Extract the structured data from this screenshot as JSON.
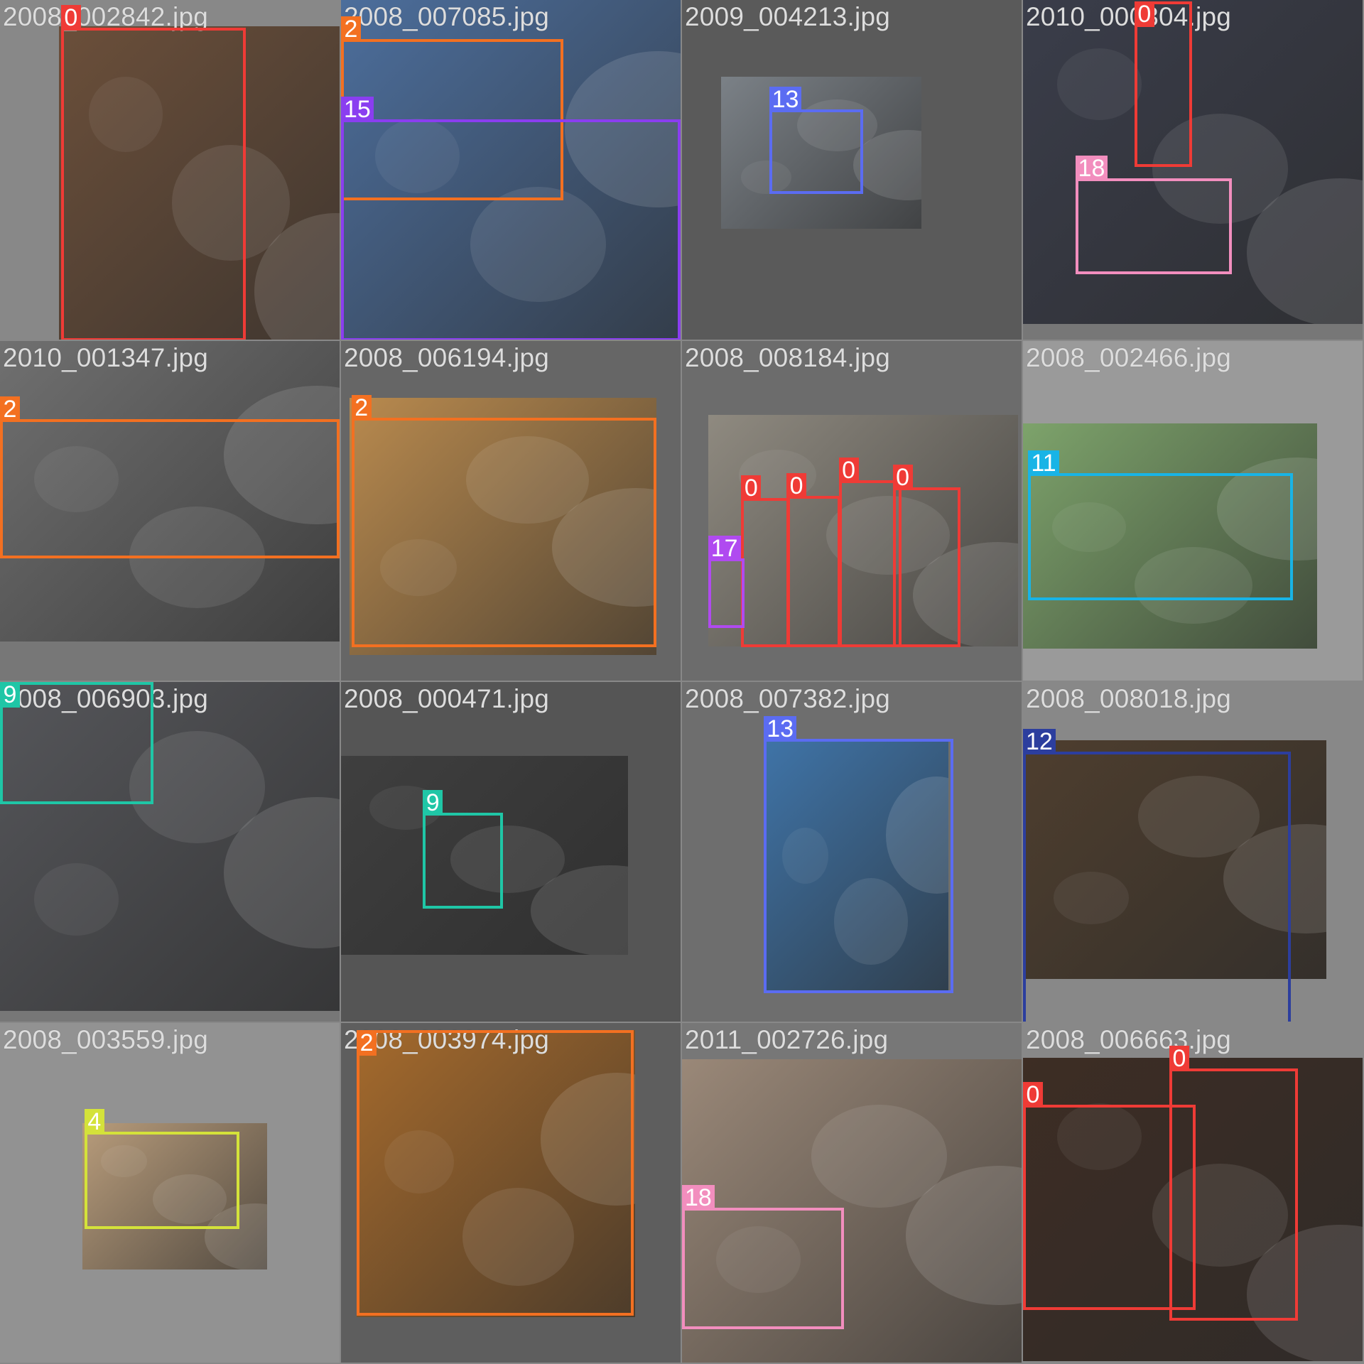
{
  "classes": {
    "0": {
      "color": "#ef3b36"
    },
    "2": {
      "color": "#f37021"
    },
    "4": {
      "color": "#d4e23a"
    },
    "9": {
      "color": "#1fc6a6"
    },
    "11": {
      "color": "#18b4e6"
    },
    "12": {
      "color": "#2c3e9e"
    },
    "13": {
      "color": "#5b6cf2"
    },
    "15": {
      "color": "#8a3ef0"
    },
    "17": {
      "color": "#b04af0"
    },
    "18": {
      "color": "#f28ebe"
    }
  },
  "tiles": [
    {
      "file": "2008_002842.jpg",
      "bg": "#888888",
      "photo": "#6b4f3a",
      "labels": [
        "0"
      ]
    },
    {
      "file": "2008_007085.jpg",
      "bg": "#888888",
      "photo": "#4c6e9c",
      "labels": [
        "2",
        "15"
      ]
    },
    {
      "file": "2009_004213.jpg",
      "bg": "#5a5a5a",
      "photo": "#7b8187",
      "labels": [
        "13"
      ]
    },
    {
      "file": "2010_000304.jpg",
      "bg": "#777777",
      "photo": "#3a3d4a",
      "labels": [
        "0",
        "18"
      ]
    },
    {
      "file": "2010_001347.jpg",
      "bg": "#777777",
      "photo": "#707070",
      "labels": [
        "2"
      ]
    },
    {
      "file": "2008_006194.jpg",
      "bg": "#666666",
      "photo": "#b98a4e",
      "labels": [
        "2"
      ]
    },
    {
      "file": "2008_008184.jpg",
      "bg": "#6c6c6c",
      "photo": "#8f8a80",
      "labels": [
        "0",
        "0",
        "0",
        "0",
        "17"
      ]
    },
    {
      "file": "2008_002466.jpg",
      "bg": "#9a9a9a",
      "photo": "#7da36b",
      "labels": [
        "11"
      ]
    },
    {
      "file": "2008_006903.jpg",
      "bg": "#777777",
      "photo": "#55565a",
      "labels": [
        "9"
      ]
    },
    {
      "file": "2008_000471.jpg",
      "bg": "#555555",
      "photo": "#3f3f3f",
      "labels": [
        "9"
      ]
    },
    {
      "file": "2008_007382.jpg",
      "bg": "#6e6e6e",
      "photo": "#3f74a8",
      "labels": [
        "13"
      ]
    },
    {
      "file": "2008_008018.jpg",
      "bg": "#888888",
      "photo": "#4e3e2e",
      "labels": [
        "12"
      ]
    },
    {
      "file": "2008_003559.jpg",
      "bg": "#929292",
      "photo": "#b89c7b",
      "labels": [
        "4"
      ]
    },
    {
      "file": "2008_003974.jpg",
      "bg": "#5e5e5e",
      "photo": "#a56a2c",
      "labels": [
        "2"
      ]
    },
    {
      "file": "2011_002726.jpg",
      "bg": "#777777",
      "photo": "#9a8878",
      "labels": [
        "18"
      ]
    },
    {
      "file": "2008_006663.jpg",
      "bg": "#888888",
      "photo": "#3d2d24",
      "labels": [
        "0",
        "0"
      ]
    }
  ]
}
